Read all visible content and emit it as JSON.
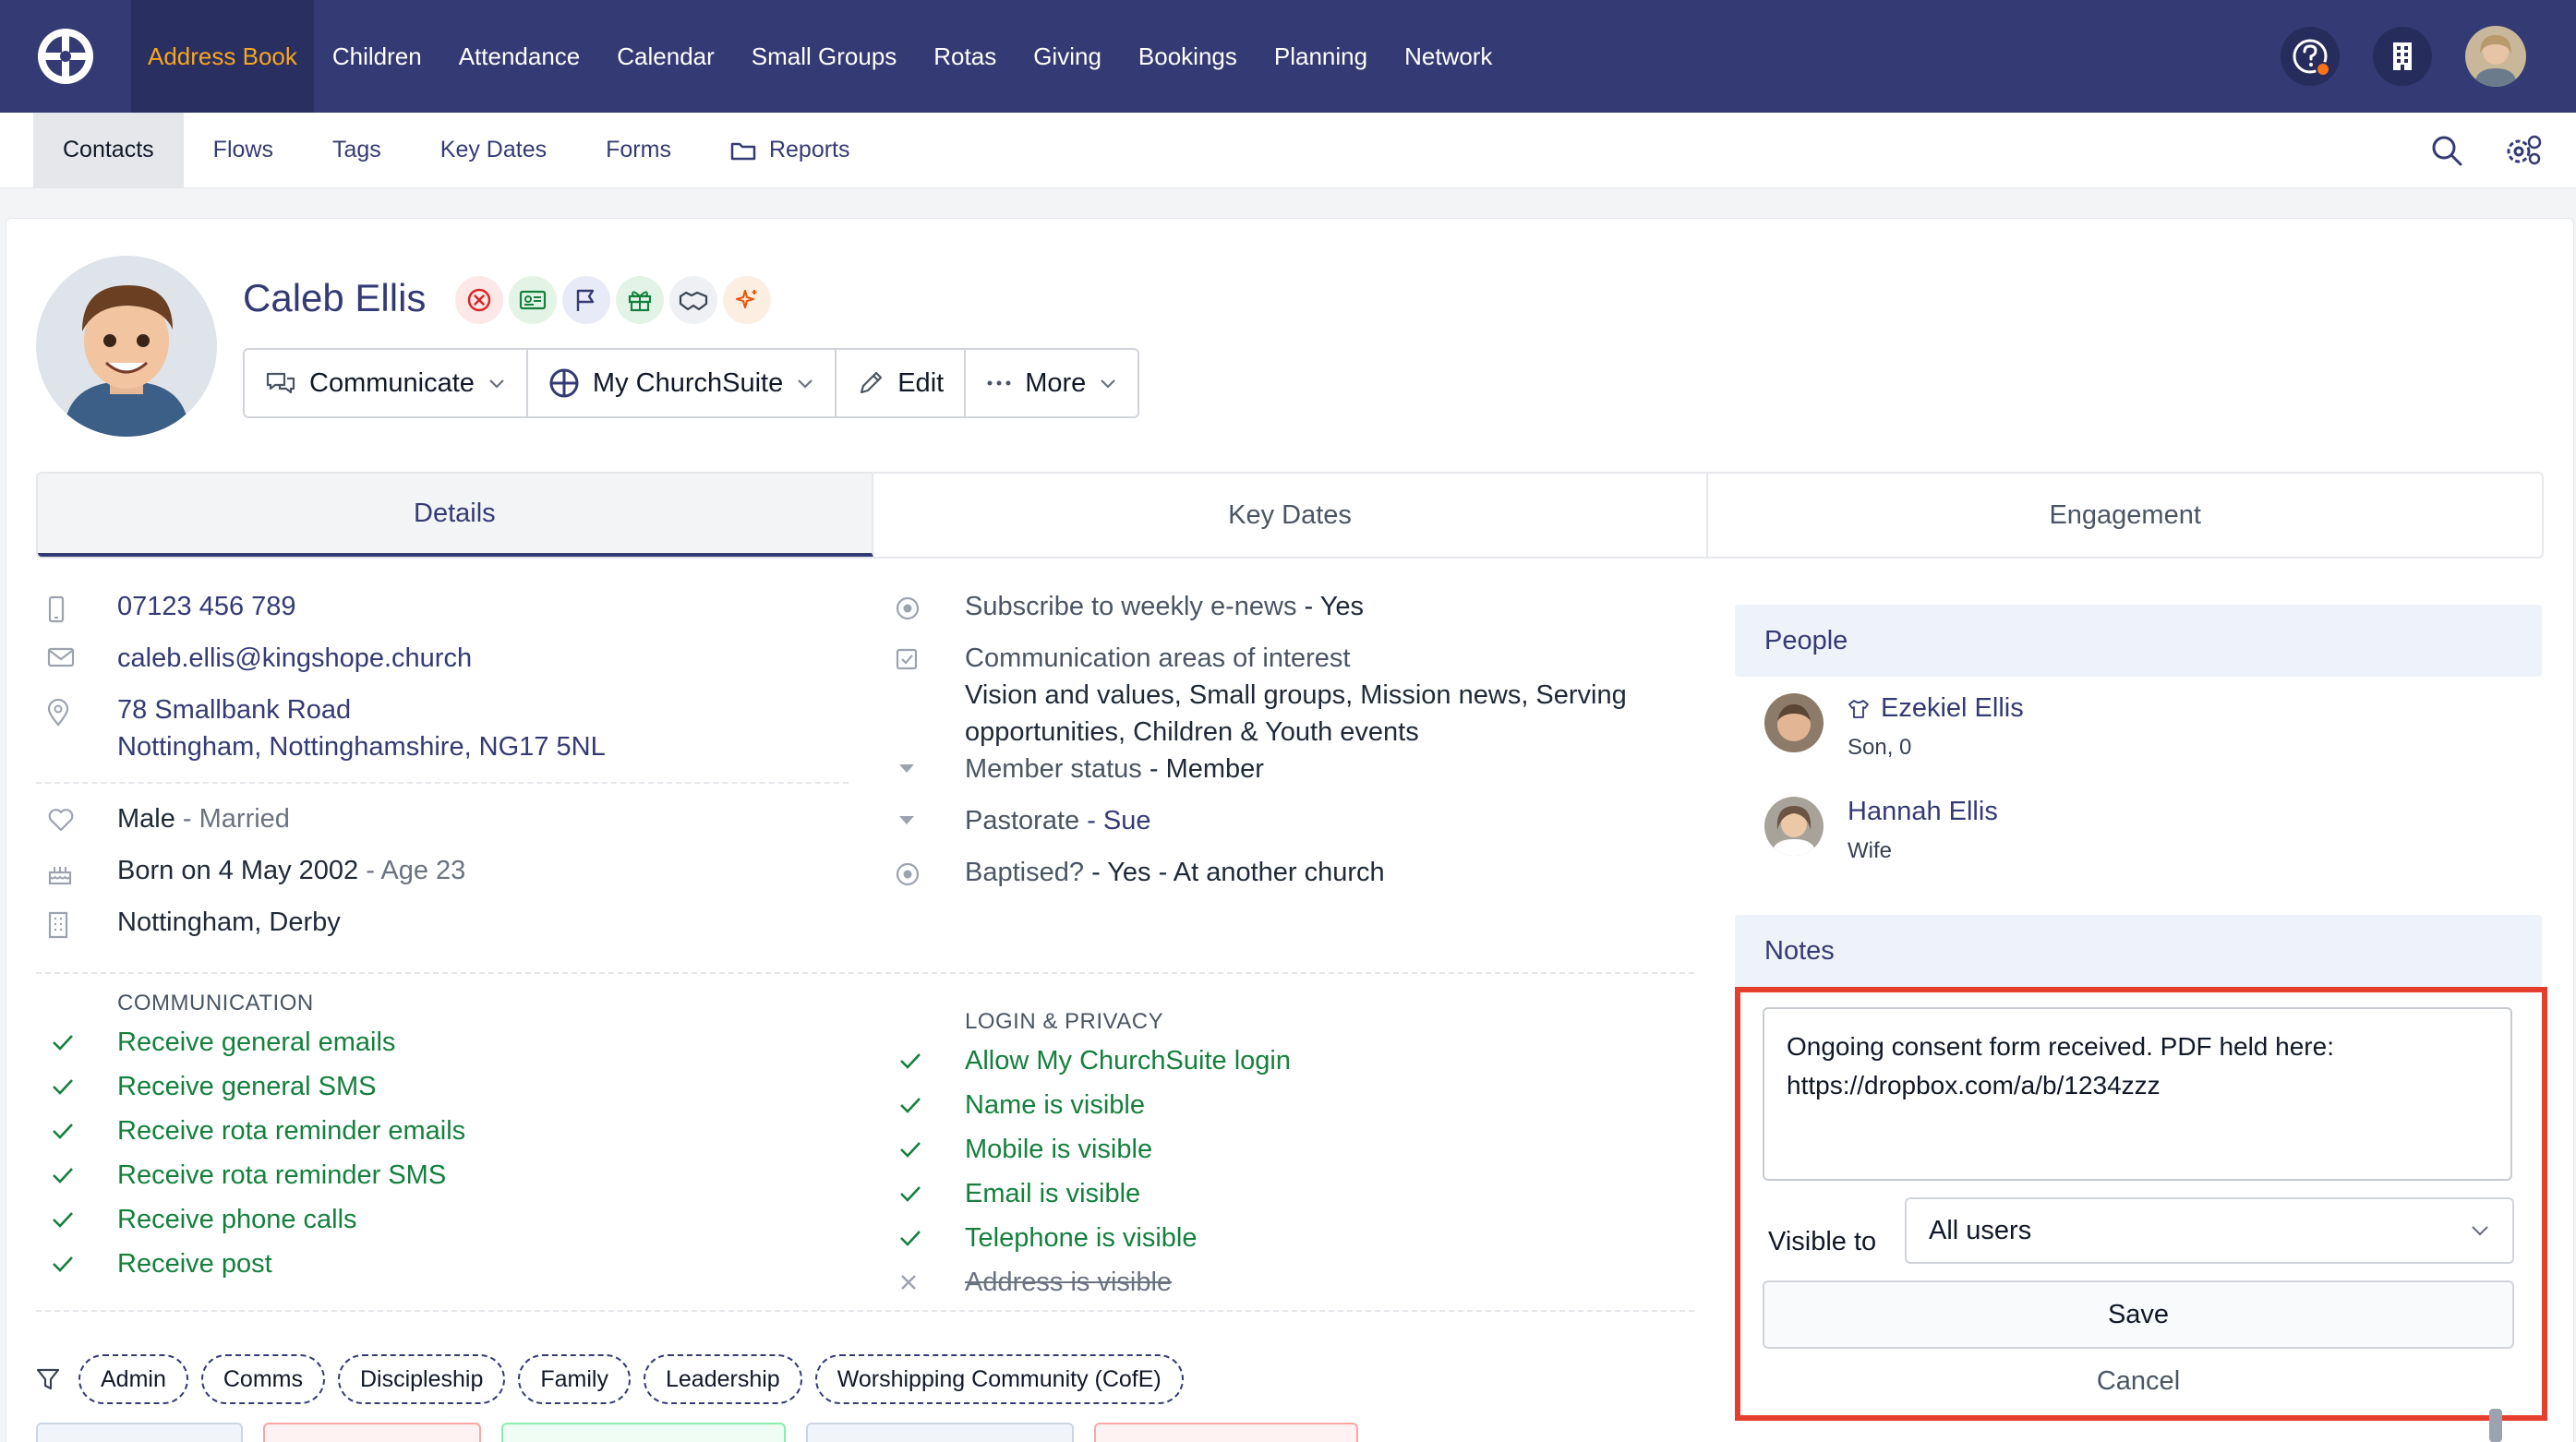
{
  "topnav": {
    "items": [
      "Address Book",
      "Children",
      "Attendance",
      "Calendar",
      "Small Groups",
      "Rotas",
      "Giving",
      "Bookings",
      "Planning",
      "Network"
    ],
    "active": "Address Book"
  },
  "subnav": {
    "items": [
      "Contacts",
      "Flows",
      "Tags",
      "Key Dates",
      "Forms",
      "Reports"
    ]
  },
  "contact": {
    "name": "Caleb Ellis",
    "actions": {
      "communicate": "Communicate",
      "my_churchsuite": "My ChurchSuite",
      "edit": "Edit",
      "more": "More"
    }
  },
  "tabs": [
    "Details",
    "Key Dates",
    "Engagement"
  ],
  "details": {
    "phone": "07123 456 789",
    "email": "caleb.ellis@kingshope.church",
    "address_line1": "78 Smallbank Road",
    "address_line2": "Nottingham, Nottinghamshire, NG17 5NL",
    "sex": "Male",
    "marital": "- Married",
    "born": "Born on 4 May 2002",
    "age": "- Age 23",
    "site": "Nottingham, Derby"
  },
  "custom_fields": {
    "enews_label": "Subscribe to weekly e-news",
    "enews_value": "- Yes",
    "interest_label": "Communication areas of interest",
    "interest_value": "Vision and values, Small groups, Mission news, Serving opportunities, Children & Youth events",
    "member_label": "Member status",
    "member_value": "- Member",
    "pastorate_label": "Pastorate",
    "pastorate_value": "- Sue",
    "baptised_label": "Baptised?",
    "baptised_value": "- Yes - At another church"
  },
  "communication": {
    "heading": "COMMUNICATION",
    "items": [
      "Receive general emails",
      "Receive general SMS",
      "Receive rota reminder emails",
      "Receive rota reminder SMS",
      "Receive phone calls",
      "Receive post"
    ]
  },
  "privacy": {
    "heading": "LOGIN & PRIVACY",
    "items": [
      "Allow My ChurchSuite login",
      "Name is visible",
      "Mobile is visible",
      "Email is visible",
      "Telephone is visible",
      "Address is visible"
    ]
  },
  "tags": [
    "Admin",
    "Comms",
    "Discipleship",
    "Family",
    "Leadership",
    "Worshipping Community (CofE)"
  ],
  "people": {
    "heading": "People",
    "list": [
      {
        "name": "Ezekiel Ellis",
        "relation": "Son, 0"
      },
      {
        "name": "Hannah Ellis",
        "relation": "Wife"
      }
    ]
  },
  "notes": {
    "heading": "Notes",
    "text": "Ongoing consent form received. PDF held here: https://dropbox.com/a/b/1234zzz",
    "visible_label": "Visible to",
    "visible_value": "All users",
    "save": "Save",
    "cancel": "Cancel"
  },
  "colors": {
    "nav_bg": "#343b74",
    "nav_active_text": "#f5a623",
    "link": "#343b74",
    "check": "#15803d",
    "highlight_border": "#e53e2e"
  }
}
